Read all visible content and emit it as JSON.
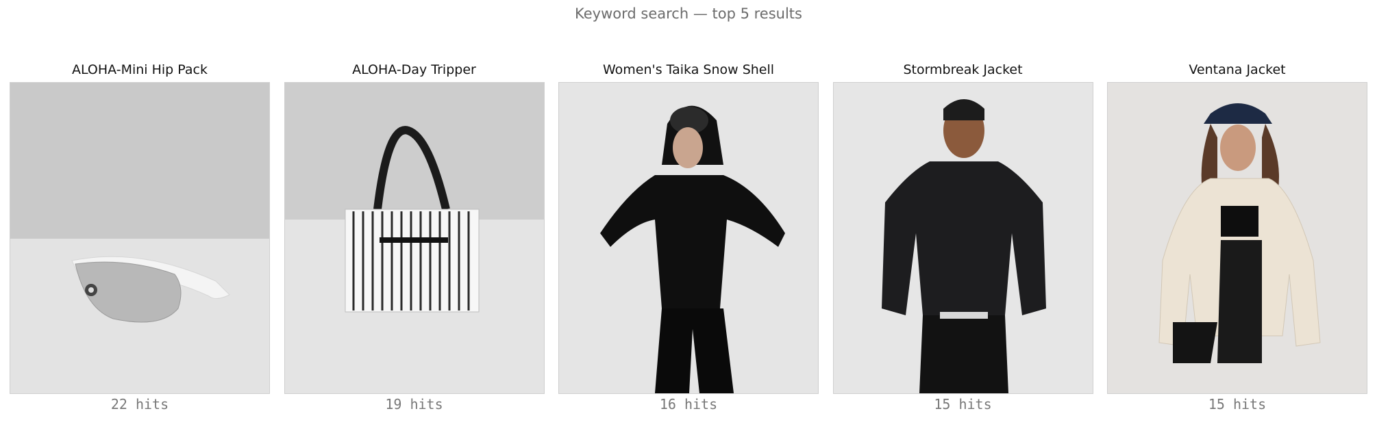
{
  "header": {
    "title": "Keyword search — top 5 results"
  },
  "results": [
    {
      "name": "ALOHA-Mini Hip Pack",
      "hits": "22 hits",
      "icon": "hip-pack-image"
    },
    {
      "name": "ALOHA-Day Tripper",
      "hits": "19 hits",
      "icon": "tote-bag-image"
    },
    {
      "name": "Women's Taika Snow Shell",
      "hits": "16 hits",
      "icon": "snow-shell-jacket-image"
    },
    {
      "name": "Stormbreak Jacket",
      "hits": "15 hits",
      "icon": "stormbreak-jacket-image"
    },
    {
      "name": "Ventana Jacket",
      "hits": "15 hits",
      "icon": "ventana-jacket-image"
    }
  ]
}
